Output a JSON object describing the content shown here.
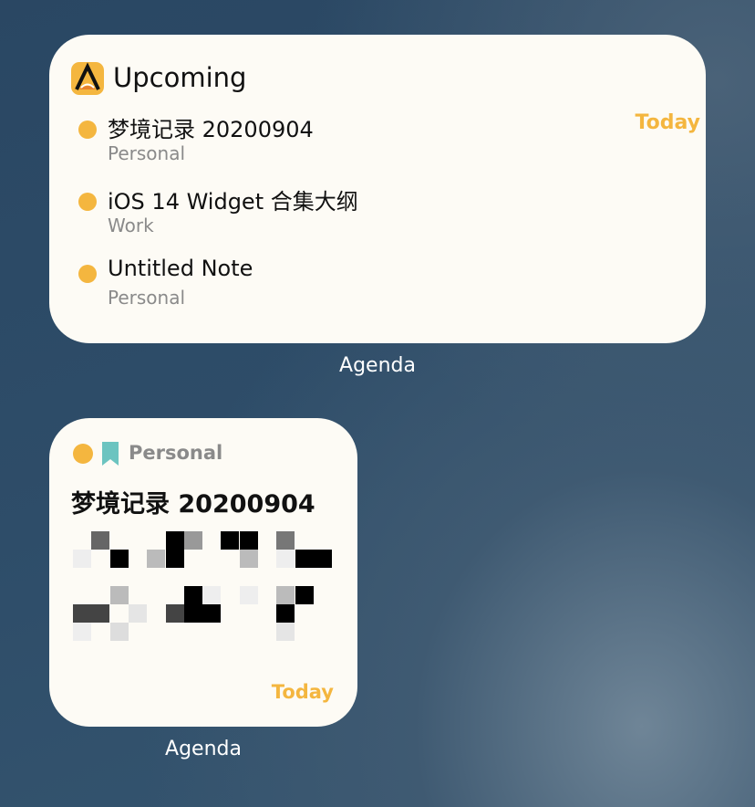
{
  "upcoming_widget": {
    "title": "Upcoming",
    "items": [
      {
        "title": "梦境记录 20200904",
        "notebook": "Personal",
        "date": "Today"
      },
      {
        "title": "iOS 14 Widget 合集大纲",
        "notebook": "Work"
      },
      {
        "title": "Untitled Note",
        "notebook": "Personal"
      }
    ],
    "app_label": "Agenda"
  },
  "note_widget": {
    "notebook": "Personal",
    "title": "梦境记录 20200904",
    "date": "Today",
    "app_label": "Agenda"
  },
  "colors": {
    "accent": "#f4b63f",
    "bookmark": "#6cc4c0"
  }
}
